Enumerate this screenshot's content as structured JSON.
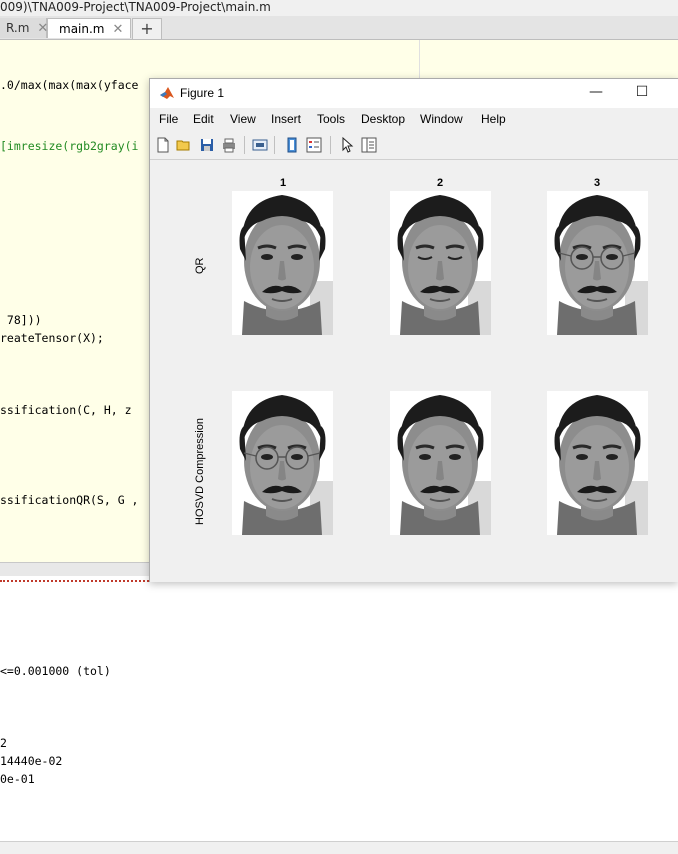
{
  "editor": {
    "path": "009)\\TNA009-Project\\TNA009-Project\\main.m",
    "tabs": [
      {
        "label": "R.m",
        "active": false
      },
      {
        "label": "main.m",
        "active": true
      }
    ],
    "code_lines": [
      {
        "text": ".0/max(max(max(yface",
        "color": "black"
      },
      {
        "text": "[imresize(rgb2gray(i",
        "color": "green"
      },
      {
        "text": " 78]))",
        "color": "black"
      },
      {
        "text": "reateTensor(X);",
        "color": "black"
      },
      {
        "text": "ssification(C, H, z",
        "color": "black"
      },
      {
        "text": "ssificationQR(S, G ,",
        "color": "black"
      }
    ]
  },
  "command_window": {
    "lines": [
      "<=0.001000 (tol)",
      "2",
      "14440e-02",
      "0e-01"
    ]
  },
  "figure": {
    "title": "Figure 1",
    "menu": [
      "File",
      "Edit",
      "View",
      "Insert",
      "Tools",
      "Desktop",
      "Window",
      "Help"
    ],
    "toolbar_icons": [
      "new-file-icon",
      "open-folder-icon",
      "save-icon",
      "print-icon",
      "print-preview-icon",
      "link-icon",
      "legend-icon",
      "pointer-icon",
      "property-inspector-icon"
    ],
    "column_titles": [
      "1",
      "2",
      "3"
    ],
    "row_labels": [
      "QR",
      "HOSVD Compression"
    ],
    "faces": [
      {
        "row": 0,
        "col": 0,
        "glasses": false,
        "eyes_closed": false
      },
      {
        "row": 0,
        "col": 1,
        "glasses": false,
        "eyes_closed": true
      },
      {
        "row": 0,
        "col": 2,
        "glasses": true,
        "eyes_closed": false
      },
      {
        "row": 1,
        "col": 0,
        "glasses": true,
        "eyes_closed": false
      },
      {
        "row": 1,
        "col": 1,
        "glasses": false,
        "eyes_closed": false
      },
      {
        "row": 1,
        "col": 2,
        "glasses": false,
        "eyes_closed": false
      }
    ]
  }
}
